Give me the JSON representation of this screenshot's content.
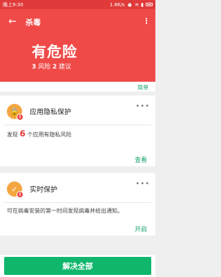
{
  "status_bar": {
    "time": "晚上9:30",
    "right_text": "1.8K/s",
    "icons": [
      "alarm-icon",
      "wifi-icon",
      "signal-icon",
      "battery-icon"
    ]
  },
  "header": {
    "title": "杀毒",
    "status": "有危险",
    "risk_count": "3",
    "risk_label": "风险",
    "suggest_count": "2",
    "suggest_label": "建议",
    "bg_color": "#f04a48"
  },
  "top_card": {
    "link": "简单"
  },
  "cards": [
    {
      "title": "应用隐私保护",
      "desc_prefix": "发现",
      "desc_count": "6",
      "desc_suffix": "个应用有隐私风险",
      "action": "查看",
      "icon": "lock-icon",
      "badge": "!"
    },
    {
      "title": "实时保护",
      "desc": "可在病毒安装的第一时间发现病毒并给出通知。",
      "action": "开启",
      "icon": "shield-check-icon",
      "badge": "!"
    }
  ],
  "footer": {
    "button": "解决全部",
    "button_color": "#0fb66b"
  }
}
